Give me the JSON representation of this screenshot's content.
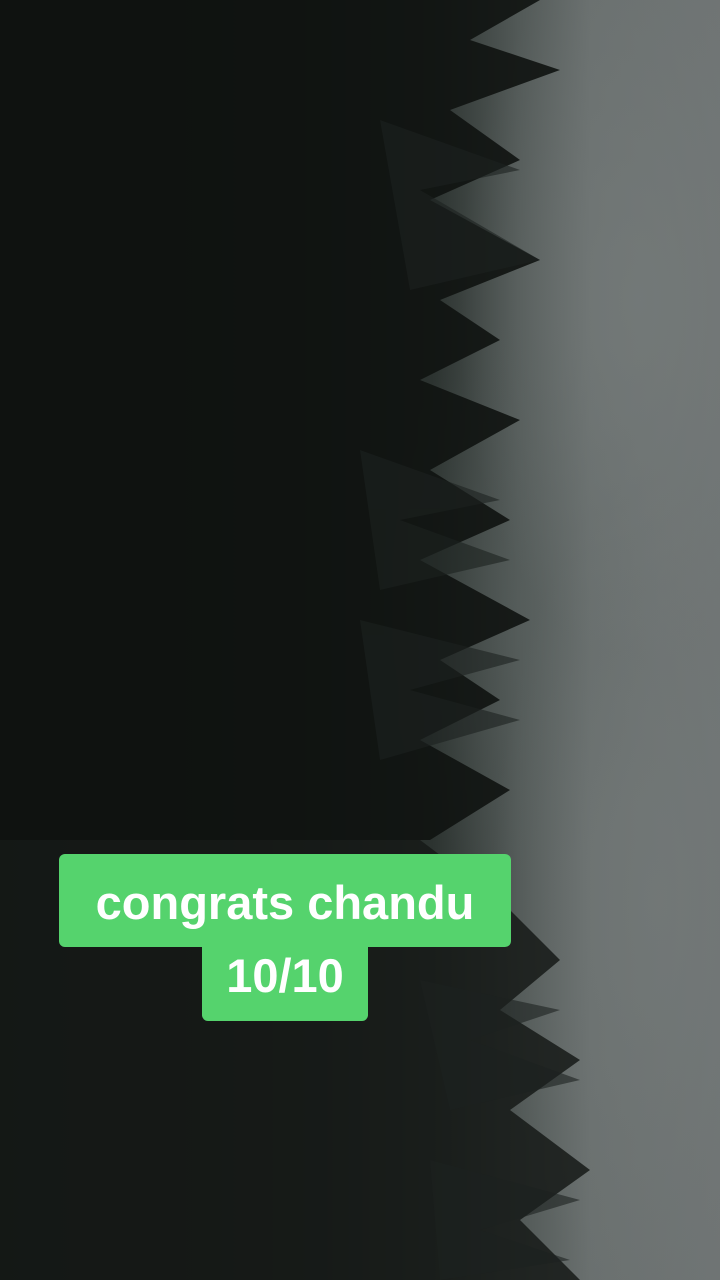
{
  "caption": {
    "line1": "congrats chandu",
    "line2": "10/10"
  },
  "colors": {
    "caption_background": "#55d36d",
    "caption_text": "#ffffff",
    "forest_dark": "#0c0e0d",
    "fog_grey": "#6f7474"
  },
  "scene": {
    "description_icon": "misty-forest-background"
  }
}
